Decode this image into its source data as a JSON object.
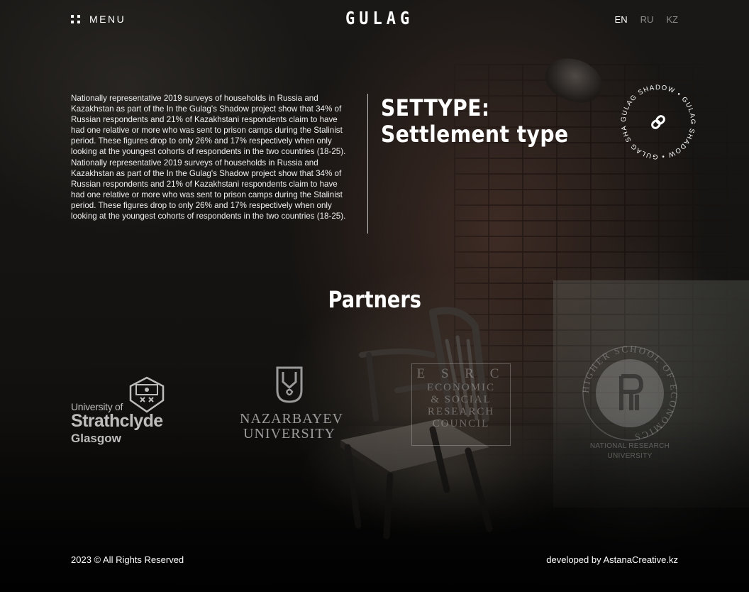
{
  "header": {
    "menu_label": "MENU",
    "logo": "GULAG",
    "languages": [
      "EN",
      "RU",
      "KZ"
    ],
    "active_language": "EN"
  },
  "intro": {
    "description": "Nationally representative 2019 surveys of households in Russia and Kazakhstan as part of the In the Gulag's Shadow project show that 34% of Russian respondents and 21% of Kazakhstani respondents claim to have had one relative or more who was sent to prison camps during the Stalinist period. These figures drop to only 26% and 17% respectively when only looking at the youngest cohorts of respondents in the two countries (18-25). Nationally representative 2019 surveys of households in Russia and Kazakhstan as part of the In the Gulag's Shadow project show that 34% of Russian respondents and 21% of Kazakhstani respondents claim to have had one relative or more who was sent to prison camps during the Stalinist period. These figures drop to only 26% and 17% respectively when only looking at the youngest cohorts of respondents in the two countries (18-25).",
    "heading": "SETTYPE: Settlement type",
    "badge_text": "GULAG SHADOW • GULAG SHADOW • GULAG SHADOW •",
    "badge_icon": "link-icon"
  },
  "partners": {
    "title": "Partners",
    "strathclyde": {
      "line1": "University of",
      "line2": "Strathclyde",
      "line3": "Glasgow"
    },
    "nazarbayev": {
      "line1": "NAZARBAYEV",
      "line2": "UNIVERSITY"
    },
    "esrc": {
      "line0": "E S R C",
      "line1": "ECONOMIC",
      "line2": "& SOCIAL",
      "line3": "RESEARCH",
      "line4": "COUNCIL"
    },
    "hse": {
      "ring": "HIGHER SCHOOL OF ECONOMICS",
      "line1": "NATIONAL RESEARCH",
      "line2": "UNIVERSITY"
    }
  },
  "footer": {
    "copyright": "2023 © All Rights Reserved",
    "developer": "developed by AstanaCreative.kz"
  },
  "colors": {
    "text": "#ffffff",
    "muted": "#8c8c8c",
    "background": "#0c0b0a"
  }
}
